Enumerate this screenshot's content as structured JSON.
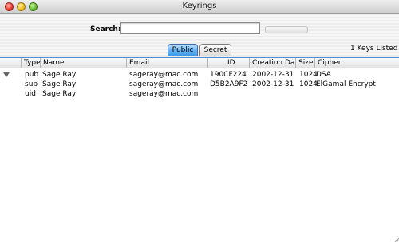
{
  "window": {
    "title": "Keyrings"
  },
  "search": {
    "label": "Search:",
    "value": "",
    "placeholder": ""
  },
  "tabs": [
    {
      "label": "Public",
      "selected": true
    },
    {
      "label": "Secret",
      "selected": false
    }
  ],
  "status": {
    "keys_listed": "1  Keys Listed"
  },
  "table": {
    "columns": [
      "Type",
      "Name",
      "Email",
      "ID",
      "Creation Date",
      "Size",
      "Cipher"
    ],
    "rows": [
      {
        "type": "pub",
        "name": "Sage Ray",
        "email": "sageray@mac.com",
        "id": "190CF224",
        "date": "2002-12-31",
        "size": "1024",
        "cipher": "DSA"
      },
      {
        "type": "sub",
        "name": "Sage Ray",
        "email": "sageray@mac.com",
        "id": "D5B2A9F2",
        "date": "2002-12-31",
        "size": "1024",
        "cipher": "ElGamal Encrypt"
      },
      {
        "type": "uid",
        "name": "Sage Ray",
        "email": "sageray@mac.com",
        "id": "",
        "date": "",
        "size": "",
        "cipher": ""
      }
    ]
  },
  "colors": {
    "tab_selected": "#5fb0f5",
    "table_border": "#4a90d9"
  }
}
